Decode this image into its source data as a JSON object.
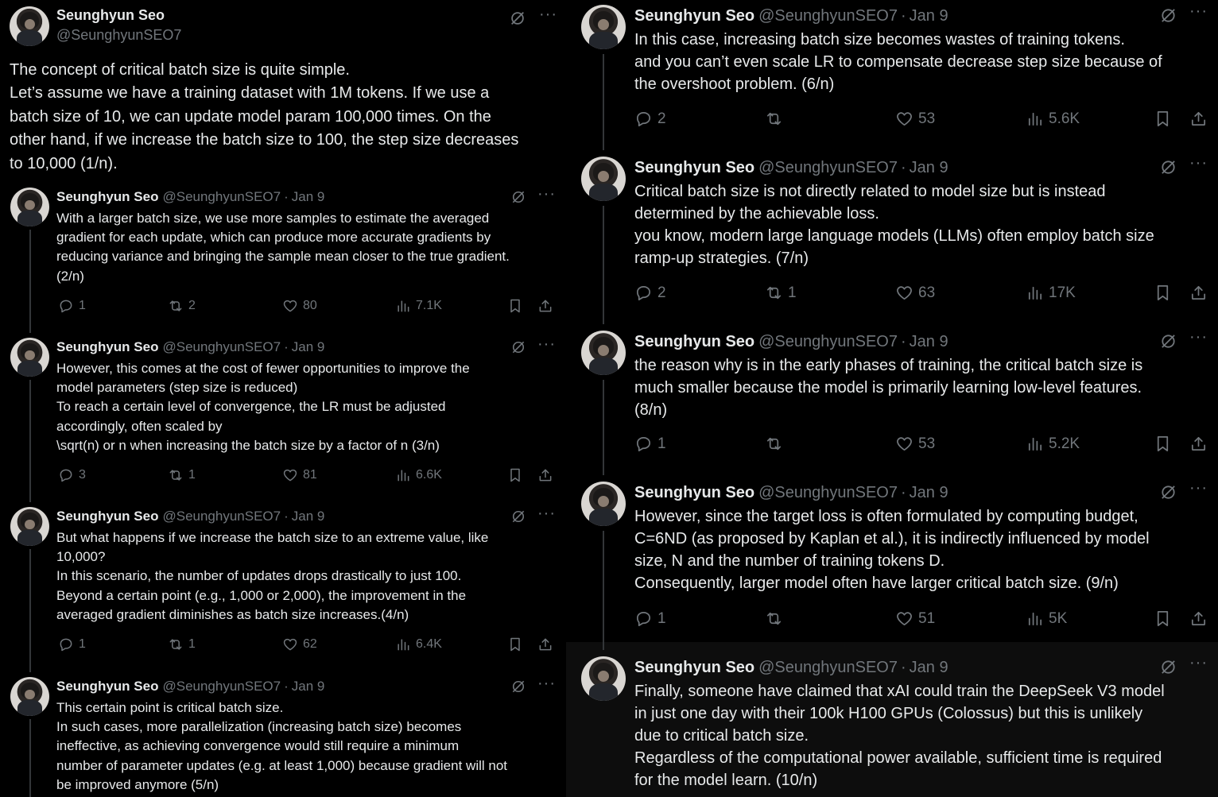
{
  "left": {
    "main": {
      "name": "Seunghyun Seo",
      "handle": "@SeunghyunSEO7",
      "lines": [
        "The concept of critical batch size is quite simple.",
        "Let’s assume we have a training dataset with 1M tokens. If we use a",
        "batch size of 10, we can update model param 100,000 times. On the",
        "other hand, if we increase the batch size to 100, the step size decreases",
        "to 10,000 (1/n)."
      ]
    },
    "replies": [
      {
        "name": "Seunghyun Seo",
        "handle": "@SeunghyunSEO7",
        "date": "Jan 9",
        "lines": [
          "With a larger batch size, we use more samples to estimate the averaged",
          "gradient for each update, which can produce more accurate gradients by",
          "reducing variance and bringing the sample mean closer to the true gradient.",
          "(2/n)"
        ],
        "replies": "1",
        "reposts": "2",
        "likes": "80",
        "views": "7.1K"
      },
      {
        "name": "Seunghyun Seo",
        "handle": "@SeunghyunSEO7",
        "date": "Jan 9",
        "lines": [
          "However, this comes at the cost of fewer opportunities to improve the",
          "model parameters (step size is reduced)",
          "To reach a certain level of convergence, the LR must be adjusted",
          "accordingly, often scaled by",
          "\\sqrt(n) or n when increasing the batch size by a factor of n (3/n)"
        ],
        "replies": "3",
        "reposts": "1",
        "likes": "81",
        "views": "6.6K"
      },
      {
        "name": "Seunghyun Seo",
        "handle": "@SeunghyunSEO7",
        "date": "Jan 9",
        "lines": [
          "But what happens if we increase the batch size to an extreme value, like",
          "10,000?",
          "In this scenario, the number of updates drops drastically to just 100.",
          "Beyond a certain point (e.g., 1,000 or 2,000), the improvement in the",
          "averaged gradient diminishes as batch size increases.(4/n)"
        ],
        "replies": "1",
        "reposts": "1",
        "likes": "62",
        "views": "6.4K"
      },
      {
        "name": "Seunghyun Seo",
        "handle": "@SeunghyunSEO7",
        "date": "Jan 9",
        "lines": [
          "This certain point is critical batch size.",
          "In such cases, more parallelization (increasing batch size) becomes",
          "ineffective, as achieving convergence would still require a minimum",
          "number of parameter updates (e.g. at least 1,000) because gradient will not",
          "be improved anymore (5/n)"
        ]
      }
    ]
  },
  "right": {
    "tweets": [
      {
        "name": "Seunghyun Seo",
        "handle": "@SeunghyunSEO7",
        "date": "Jan 9",
        "lines": [
          "In this case, increasing batch size becomes wastes of training tokens.",
          "and you can’t even scale LR to compensate decrease step size because of",
          "the overshoot problem. (6/n)"
        ],
        "replies": "2",
        "reposts": "",
        "likes": "53",
        "views": "5.6K"
      },
      {
        "name": "Seunghyun Seo",
        "handle": "@SeunghyunSEO7",
        "date": "Jan 9",
        "lines": [
          "Critical batch size is not directly related to model size but is instead",
          "determined by the achievable loss.",
          "you know, modern large language models (LLMs) often employ batch size",
          "ramp-up strategies. (7/n)"
        ],
        "replies": "2",
        "reposts": "1",
        "likes": "63",
        "views": "17K"
      },
      {
        "name": "Seunghyun Seo",
        "handle": "@SeunghyunSEO7",
        "date": "Jan 9",
        "lines": [
          "the reason why is in the early phases of training, the critical batch size is",
          "much smaller because the model is primarily learning low-level features.",
          "(8/n)"
        ],
        "replies": "1",
        "reposts": "",
        "likes": "53",
        "views": "5.2K"
      },
      {
        "name": "Seunghyun Seo",
        "handle": "@SeunghyunSEO7",
        "date": "Jan 9",
        "lines": [
          "However, since the target loss is often formulated by computing budget,",
          "C=6ND (as proposed by Kaplan et al.), it is indirectly influenced by model",
          "size, N and the number of training tokens D.",
          "Consequently, larger model often have larger critical batch size. (9/n)"
        ],
        "replies": "1",
        "reposts": "",
        "likes": "51",
        "views": "5K"
      },
      {
        "name": "Seunghyun Seo",
        "handle": "@SeunghyunSEO7",
        "date": "Jan 9",
        "lines": [
          "Finally, someone have claimed that xAI could train the DeepSeek V3 model",
          "in just one day with their 100k H100 GPUs (Colossus) but this is unlikely",
          "due to critical batch size.",
          "Regardless of the computational power available, sufficient time is required",
          "for the model learn. (10/n)"
        ]
      }
    ]
  },
  "colors": {
    "bg": "#000000",
    "text": "#e7e9ea",
    "muted": "#71767b",
    "line": "#333639"
  },
  "icons": [
    "grok-icon",
    "more-icon",
    "reply-icon",
    "repost-icon",
    "like-icon",
    "views-icon",
    "bookmark-icon",
    "share-icon"
  ]
}
